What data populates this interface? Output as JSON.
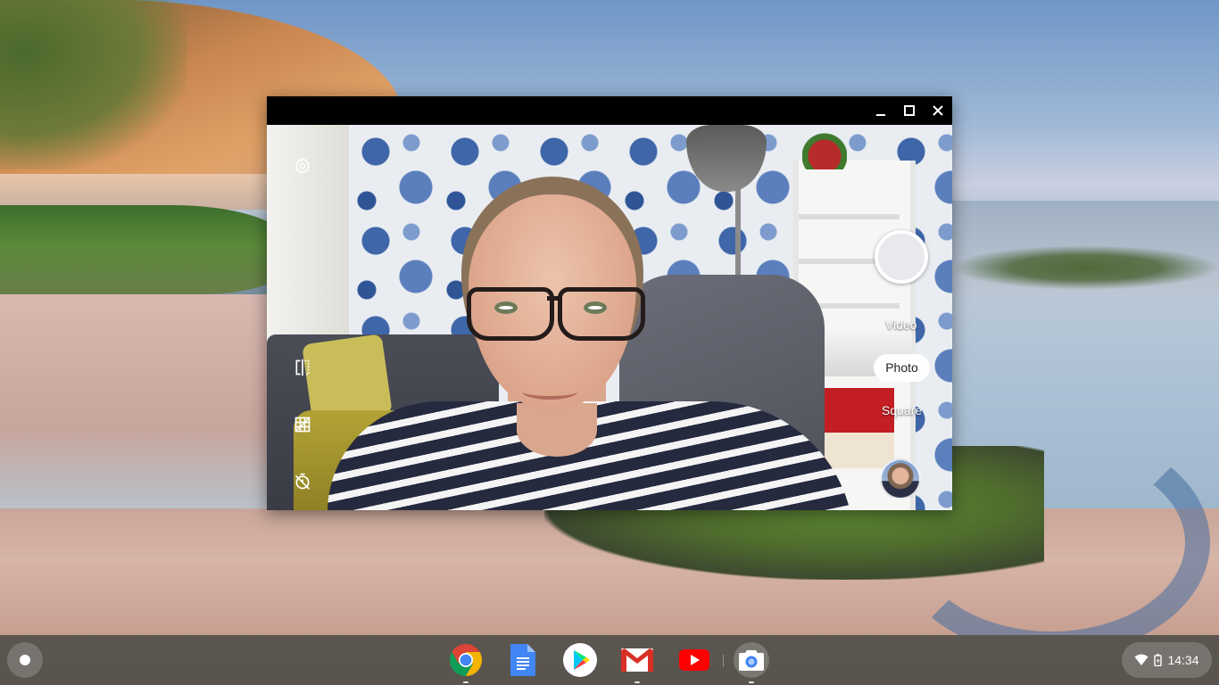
{
  "camera": {
    "modes": [
      {
        "label": "Video"
      },
      {
        "label": "Photo"
      },
      {
        "label": "Square"
      }
    ],
    "selected_mode": "Photo"
  },
  "shelf": {
    "apps": [
      {
        "name": "Chrome",
        "icon": "chrome-icon",
        "running": true
      },
      {
        "name": "Docs",
        "icon": "docs-icon",
        "running": false
      },
      {
        "name": "Play Store",
        "icon": "play-store-icon",
        "running": false
      },
      {
        "name": "Gmail",
        "icon": "gmail-icon",
        "running": true
      },
      {
        "name": "YouTube",
        "icon": "youtube-icon",
        "running": false
      },
      {
        "name": "Camera",
        "icon": "camera-icon",
        "running": true,
        "active": true
      }
    ],
    "status": {
      "time": "14:34",
      "icons": [
        "wifi-icon",
        "battery-icon"
      ]
    }
  },
  "colors": {
    "shelf_bg": "#3c3f3a",
    "photo_pill_bg": "#ffffff",
    "titlebar_bg": "#000000"
  }
}
